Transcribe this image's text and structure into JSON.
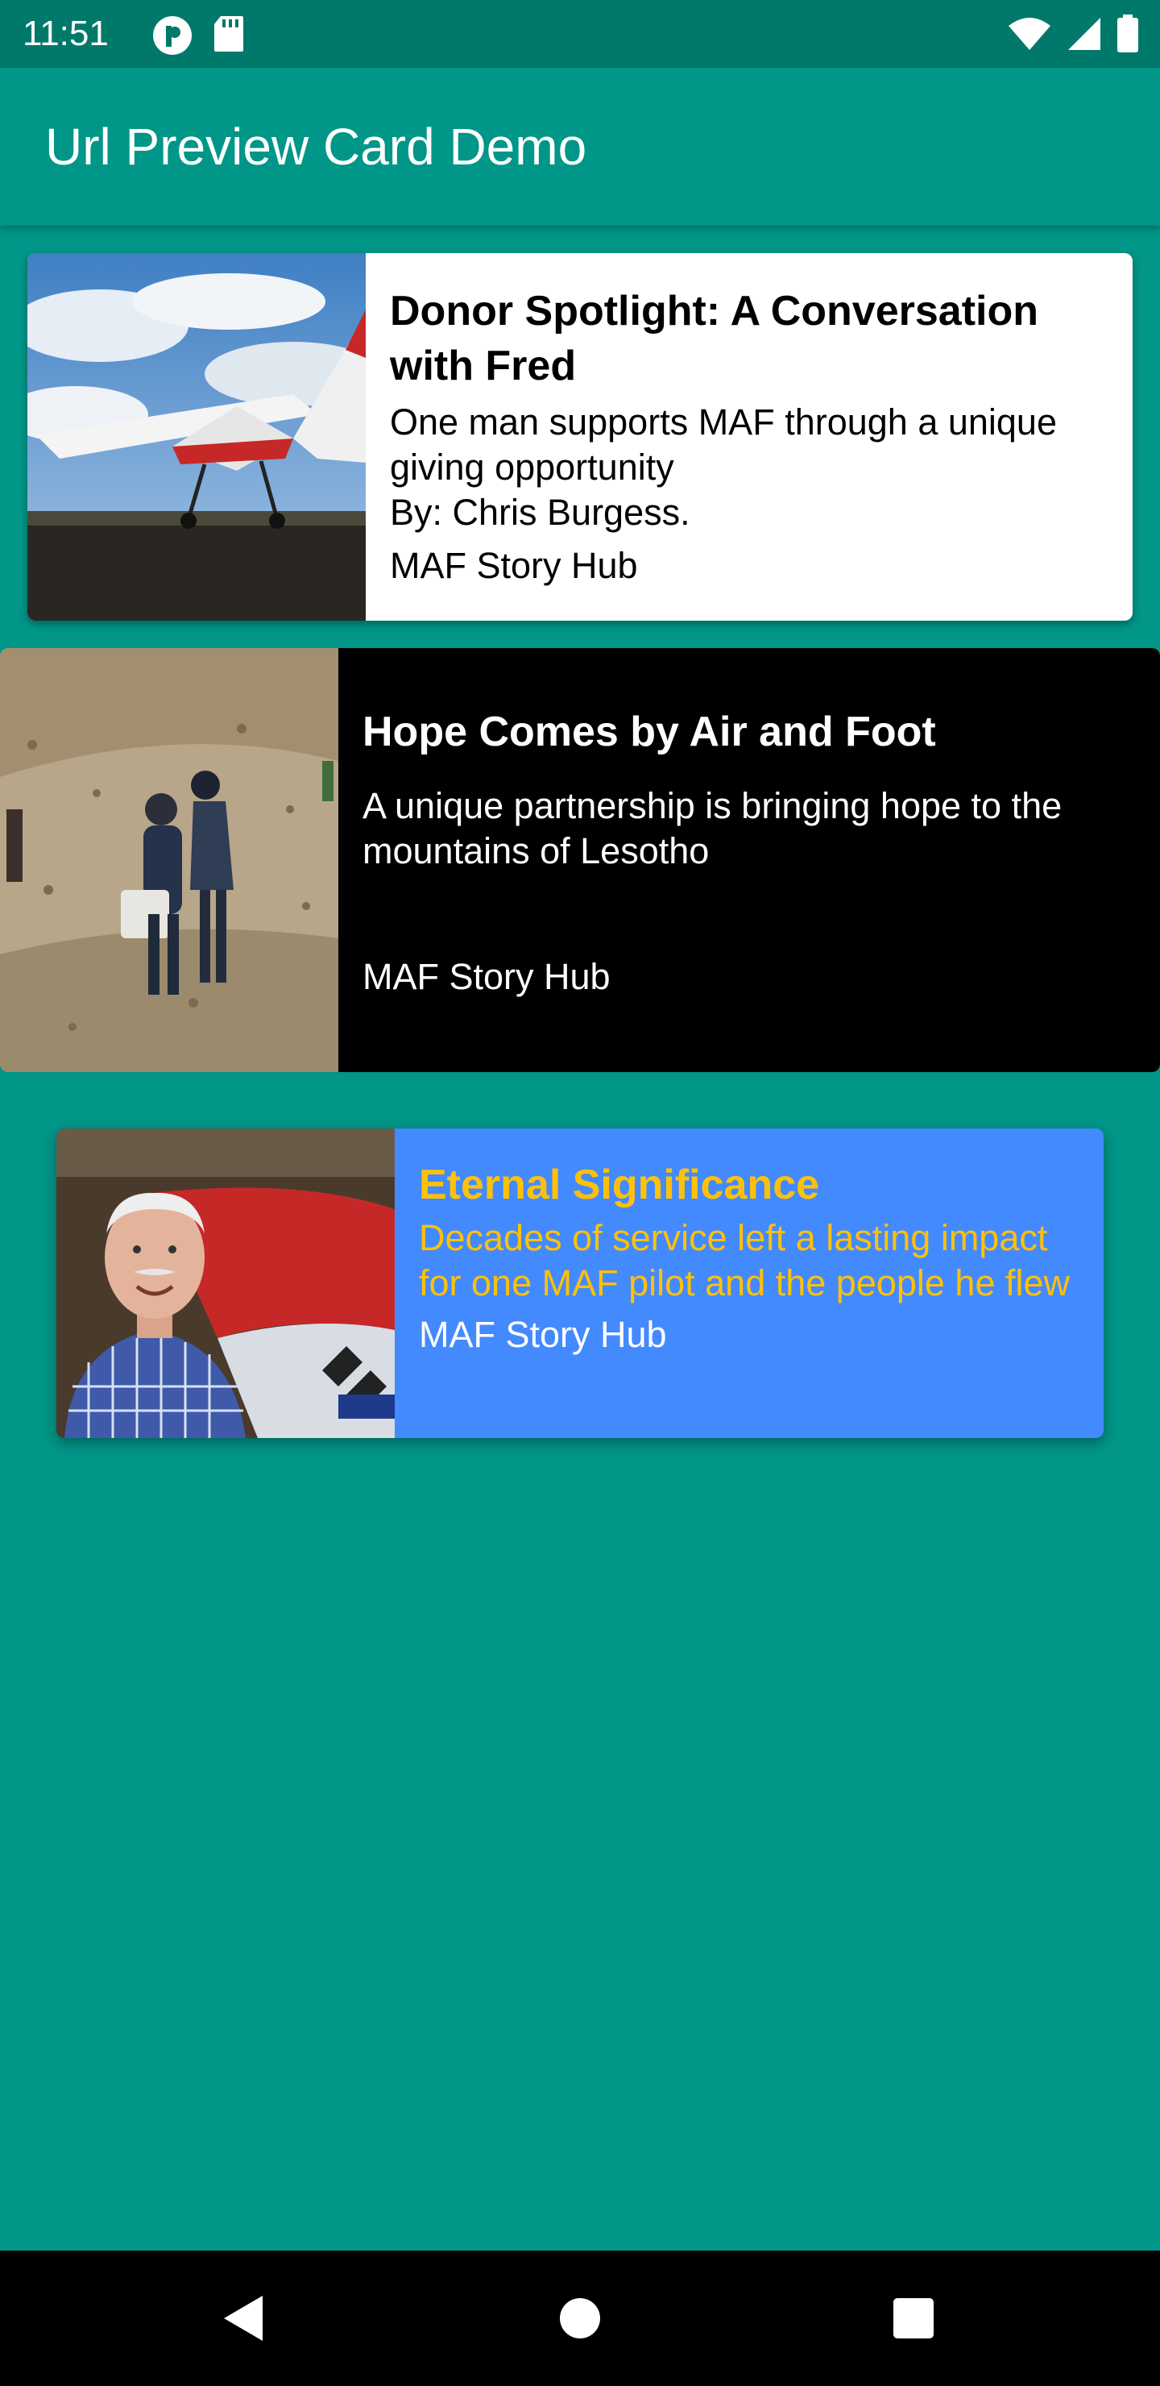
{
  "status_bar": {
    "time": "11:51",
    "left_icons": [
      "circle-p-icon",
      "sd-card-icon"
    ],
    "right_icons": [
      "wifi-icon",
      "cell-signal-icon",
      "battery-icon"
    ]
  },
  "app_bar": {
    "title": "Url Preview Card Demo"
  },
  "colors": {
    "background": "#009688",
    "status_bar": "#00796b",
    "card1_bg": "#ffffff",
    "card2_bg": "#000000",
    "card3_bg": "#448aff",
    "card3_title": "#ffc107"
  },
  "cards": [
    {
      "image": "airplane-photo",
      "title": "Donor Spotlight: A Conversation with Fred",
      "description": "One man supports MAF through a unique giving opportunity\nBy: Chris Burgess.",
      "site": "MAF Story Hub"
    },
    {
      "image": "people-on-hillside-photo",
      "title": "Hope Comes by Air and Foot",
      "description": "A unique partnership is bringing hope to the mountains of Lesotho",
      "site": "MAF Story Hub"
    },
    {
      "image": "pilot-portrait-photo",
      "title": "Eternal Significance",
      "description": "Decades of service left a lasting impact for one MAF pilot and the people he flew",
      "site": "MAF Story Hub"
    }
  ],
  "nav_bar": {
    "buttons": [
      "back-icon",
      "home-icon",
      "recents-icon"
    ]
  }
}
